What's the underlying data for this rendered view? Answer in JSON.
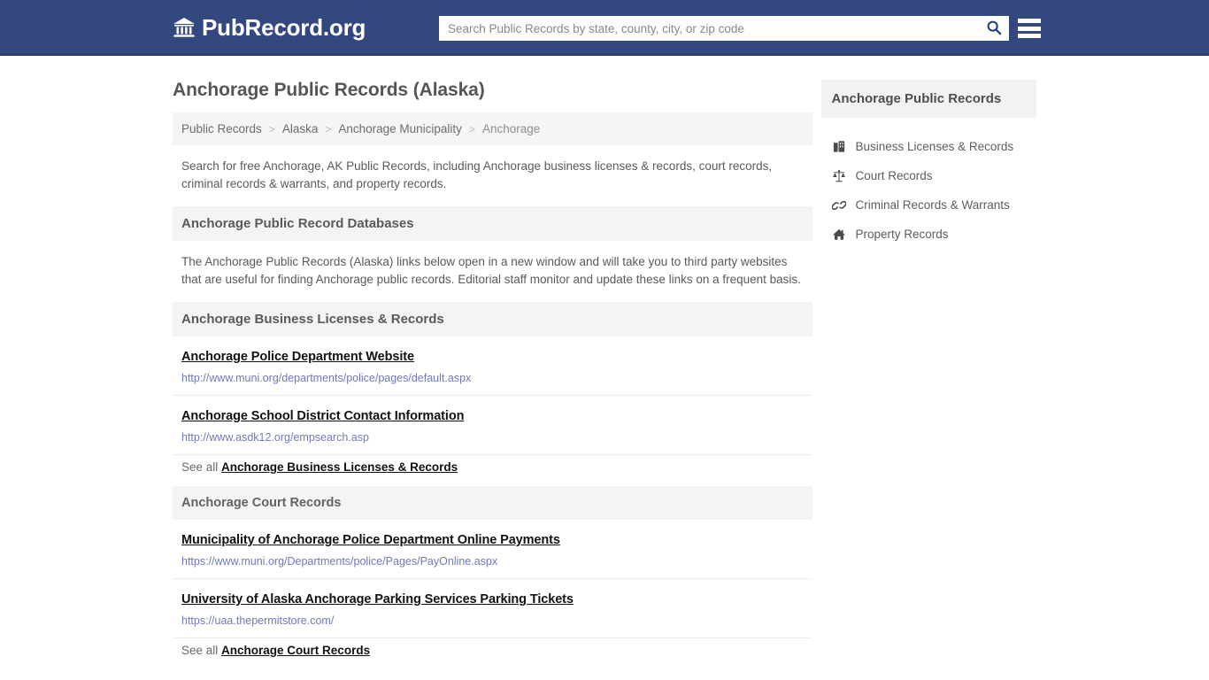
{
  "header": {
    "brand_name": "PubRecord.org",
    "brand_icon": "bank-building-icon",
    "search_placeholder": "Search Public Records by state, county, city, or zip code",
    "search_value": "",
    "search_icon": "search-icon",
    "menu_icon": "hamburger-menu-icon",
    "background_color": "#32487f"
  },
  "main": {
    "page_title": "Anchorage Public Records (Alaska)",
    "breadcrumb": {
      "separator": ">",
      "items": [
        {
          "label": "Public Records"
        },
        {
          "label": "Alaska"
        },
        {
          "label": "Anchorage Municipality"
        },
        {
          "label": "Anchorage"
        }
      ]
    },
    "intro_paragraph": "Search for free Anchorage, AK Public Records, including Anchorage business licenses & records, court records, criminal records & warrants, and property records.",
    "databases_heading": "Anchorage Public Record Databases",
    "databases_paragraph": "The Anchorage Public Records (Alaska) links below open in a new window and will take you to third party websites that are useful for finding Anchorage public records. Editorial staff monitor and update these links on a frequent basis.",
    "sections": [
      {
        "heading": "Anchorage Business Licenses & Records",
        "entries": [
          {
            "title": "Anchorage Police Department Website",
            "url": "http://www.muni.org/departments/police/pages/default.aspx"
          },
          {
            "title": "Anchorage School District Contact Information",
            "url": "http://www.asdk12.org/empsearch.asp"
          }
        ],
        "see_all_prefix": "See all",
        "see_all_link": "Anchorage Business Licenses & Records"
      },
      {
        "heading": "Anchorage Court Records",
        "entries": [
          {
            "title": "Municipality of Anchorage Police Department Online Payments",
            "url": "https://www.muni.org/Departments/police/Pages/PayOnline.aspx"
          },
          {
            "title": "University of Alaska Anchorage Parking Services Parking Tickets",
            "url": "https://uaa.thepermitstore.com/"
          }
        ],
        "see_all_prefix": "See all",
        "see_all_link": "Anchorage Court Records"
      }
    ]
  },
  "sidebar": {
    "heading": "Anchorage Public Records",
    "items": [
      {
        "label": "Business Licenses & Records",
        "icon": "briefcase-icon"
      },
      {
        "label": "Court Records",
        "icon": "scales-of-justice-icon"
      },
      {
        "label": "Criminal Records & Warrants",
        "icon": "handcuffs-link-icon"
      },
      {
        "label": "Property Records",
        "icon": "house-icon"
      }
    ]
  },
  "colors": {
    "header_blue": "#32487f",
    "link_url_blue": "#7179b8",
    "section_bg": "#f4f4f4",
    "text_gray": "#5a5a5a"
  }
}
